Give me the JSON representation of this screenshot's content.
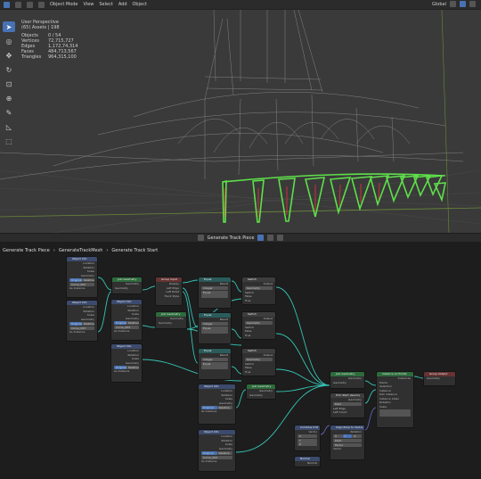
{
  "viewport": {
    "mode_label": "Object Mode",
    "menus": [
      "View",
      "Select",
      "Add",
      "Object"
    ],
    "orientation_label": "Global",
    "stats": {
      "user_line": "User Perspective",
      "collection_line": "(65) Assets | 198",
      "rows": [
        {
          "key": "Objects",
          "value": "0 / 54"
        },
        {
          "key": "Vertices",
          "value": "72,715,727"
        },
        {
          "key": "Edges",
          "value": "1,172,74,314"
        },
        {
          "key": "Faces",
          "value": "484,713,567"
        },
        {
          "key": "Triangles",
          "value": "964,315,100"
        }
      ]
    },
    "tools": [
      "select-icon",
      "cursor-icon",
      "move-icon",
      "rotate-icon",
      "scale-icon",
      "transform-icon",
      "annotate-icon",
      "measure-icon",
      "add-cube-icon"
    ]
  },
  "node_editor": {
    "header_title": "Generate Track Piece",
    "breadcrumb": [
      "Generate Track Piece",
      "GenerateTrackMesh",
      "Generate Track Start"
    ],
    "nodes": {
      "objinfo1": {
        "title": "Object Info",
        "rows": [
          "Location",
          "Rotation",
          "Scale",
          "Geometry"
        ],
        "field_a": "Original",
        "field_b": "Relative",
        "field_c": "Curve_002",
        "check": "As Instance"
      },
      "objinfo2": {
        "title": "Object Info",
        "rows": [
          "Location",
          "Rotation",
          "Scale",
          "Geometry"
        ],
        "field_a": "Original",
        "field_b": "Relative",
        "field_c": "Curve_003",
        "check": "As Instance"
      },
      "objinfo3": {
        "title": "Object Info",
        "rows": [
          "Location",
          "Rotation",
          "Scale",
          "Geometry"
        ],
        "field_a": "Original",
        "field_b": "Relative",
        "field_c": "Curve_004",
        "check": "As Instance"
      },
      "objinfo4": {
        "title": "Object Info",
        "rows": [
          "Location",
          "Rotation",
          "Scale",
          "Geometry"
        ],
        "field_a": "Original",
        "field_b": "Relative",
        "check": "As Instance"
      },
      "objinfo5": {
        "title": "Object Info",
        "rows": [
          "Location",
          "Rotation",
          "Scale",
          "Geometry"
        ],
        "field_a": "Original",
        "field_b": "Relative",
        "check": "As Instance"
      },
      "objinfo6": {
        "title": "Object Info",
        "rows": [
          "Location",
          "Rotation",
          "Scale",
          "Geometry"
        ],
        "field_a": "Original",
        "field_b": "Relative",
        "field_c": "Curve_004",
        "check": "As Instance"
      },
      "join1": {
        "title": "Join Geometry",
        "rows": [
          "Geometry",
          "Geometry"
        ]
      },
      "groupinput": {
        "title": "Group Input",
        "rows": [
          "Display",
          "Left Edge",
          "Left Rotat",
          "Track Style"
        ]
      },
      "join2": {
        "title": "Join Geometry",
        "rows": [
          "Geometry",
          "Geometry"
        ]
      },
      "equal1": {
        "title": "Equal",
        "rows": [
          "Result",
          "Integer",
          "Equal"
        ]
      },
      "equal2": {
        "title": "Equal",
        "rows": [
          "Result",
          "Integer",
          "Equal"
        ]
      },
      "equal3": {
        "title": "Equal",
        "rows": [
          "Result",
          "Integer",
          "Equal"
        ]
      },
      "switch1": {
        "title": "Switch",
        "rows": [
          "Output",
          "Geometry",
          "Switch",
          "False",
          "True"
        ]
      },
      "switch2": {
        "title": "Switch",
        "rows": [
          "Output",
          "Geometry",
          "Switch",
          "False",
          "True"
        ]
      },
      "switch3": {
        "title": "Switch",
        "rows": [
          "Output",
          "Geometry",
          "Switch",
          "False",
          "True"
        ]
      },
      "join3": {
        "title": "Join Geometry",
        "rows": [
          "Geometry",
          "Geometry"
        ]
      },
      "join4": {
        "title": "Join Geometry",
        "rows": [
          "Geometry",
          "Geometry"
        ]
      },
      "trim": {
        "title": "Trim Start (Geom)",
        "rows": [
          "Geometry",
          "Selection",
          "Field",
          "Left Edge",
          "Left Count"
        ]
      },
      "instance": {
        "title": "Instance on Points",
        "rows": [
          "Instances",
          "Points",
          "Selection",
          "Instance",
          "Pick Instance",
          "Instance Index",
          "Rotation",
          "Scale"
        ]
      },
      "output": {
        "title": "Group Output",
        "rows": [
          "Geometry"
        ]
      },
      "combine": {
        "title": "Combine XYZ",
        "rows": [
          "Vector",
          "X",
          "Y",
          "Z"
        ]
      },
      "align": {
        "title": "Align Euler to Vector",
        "rows": [
          "Rotation",
          "X",
          "Y",
          "Z",
          "Pivot",
          "Factor",
          "Vector"
        ]
      },
      "normal": {
        "title": "Normal",
        "rows": [
          "Normal"
        ]
      }
    }
  }
}
